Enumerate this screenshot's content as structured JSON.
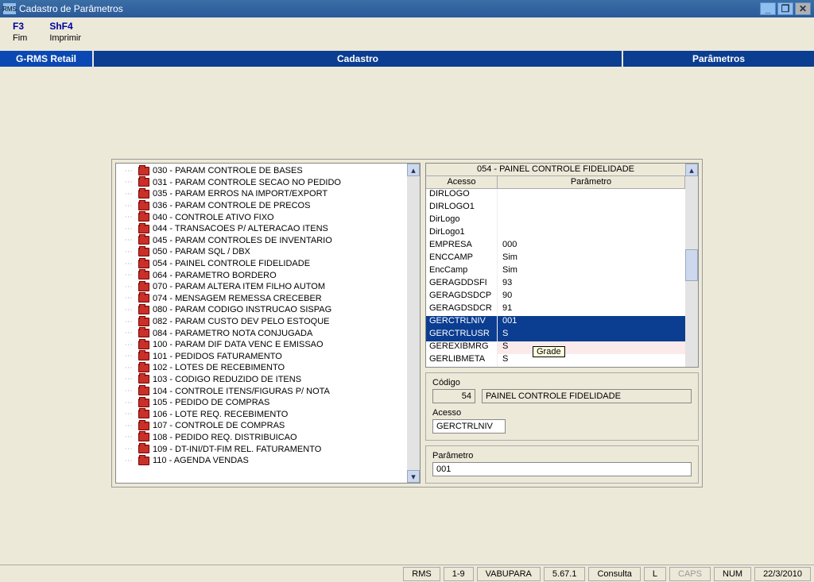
{
  "window": {
    "title": "Cadastro de Parâmetros",
    "app_icon_text": "RMS"
  },
  "menu": {
    "items": [
      {
        "shortcut": "F3",
        "label": "Fim"
      },
      {
        "shortcut": "ShF4",
        "label": "Imprimir"
      }
    ]
  },
  "ribbon": {
    "left": "G-RMS Retail",
    "center": "Cadastro",
    "right": "Parâmetros"
  },
  "tree": {
    "items": [
      "030 - PARAM CONTROLE DE BASES",
      "031 - PARAM CONTROLE SECAO NO PEDIDO",
      "035 - PARAM ERROS NA IMPORT/EXPORT",
      "036 - PARAM CONTROLE DE PRECOS",
      "040 - CONTROLE ATIVO FIXO",
      "044 - TRANSACOES P/ ALTERACAO ITENS",
      "045 - PARAM CONTROLES DE INVENTARIO",
      "050 - PARAM SQL / DBX",
      "054 - PAINEL CONTROLE FIDELIDADE",
      "064 - PARAMETRO BORDERO",
      "070 - PARAM ALTERA ITEM FILHO AUTOM",
      "074 - MENSAGEM REMESSA CRECEBER",
      "080 - PARAM CODIGO INSTRUCAO SISPAG",
      "082 - PARAM CUSTO DEV PELO ESTOQUE",
      "084 - PARAMETRO NOTA CONJUGADA",
      "100 - PARAM DIF DATA VENC E EMISSAO",
      "101 - PEDIDOS FATURAMENTO",
      "102 - LOTES DE RECEBIMENTO",
      "103 - CODIGO REDUZIDO DE ITENS",
      "104 - CONTROLE ITENS/FIGURAS P/ NOTA",
      "105 - PEDIDO DE COMPRAS",
      "106 - LOTE REQ. RECEBIMENTO",
      "107 - CONTROLE DE COMPRAS",
      "108 - PEDIDO REQ. DISTRIBUICAO",
      "109 - DT-INI/DT-FIM REL. FATURAMENTO",
      "110 - AGENDA VENDAS"
    ]
  },
  "grid": {
    "title": "054 - PAINEL CONTROLE FIDELIDADE",
    "col_acesso": "Acesso",
    "col_parametro": "Parâmetro",
    "rows": [
      {
        "acesso": "DIRLOGO",
        "param": ""
      },
      {
        "acesso": "DIRLOGO1",
        "param": ""
      },
      {
        "acesso": "DirLogo",
        "param": ""
      },
      {
        "acesso": "DirLogo1",
        "param": ""
      },
      {
        "acesso": "EMPRESA",
        "param": "000"
      },
      {
        "acesso": "ENCCAMP",
        "param": "Sim"
      },
      {
        "acesso": "EncCamp",
        "param": "Sim"
      },
      {
        "acesso": "GERAGDDSFI",
        "param": "93"
      },
      {
        "acesso": "GERAGDSDCP",
        "param": "90"
      },
      {
        "acesso": "GERAGDSDCR",
        "param": "91"
      },
      {
        "acesso": "GERCTRLNIV",
        "param": "001",
        "selected": true
      },
      {
        "acesso": "GERCTRLUSR",
        "param": "S",
        "selected": true
      },
      {
        "acesso": "GEREXIBMRG",
        "param": "S",
        "highlight": true
      },
      {
        "acesso": "GERLIBMETA",
        "param": "S"
      }
    ],
    "tooltip": "Grade"
  },
  "form": {
    "codigo_label": "Código",
    "codigo_value": "54",
    "codigo_desc": "PAINEL CONTROLE FIDELIDADE",
    "acesso_label": "Acesso",
    "acesso_value": "GERCTRLNIV",
    "param_label": "Parâmetro",
    "param_value": "001"
  },
  "status": {
    "app": "RMS",
    "pages": "1-9",
    "prog": "VABUPARA",
    "ver": "5.67.1",
    "mode": "Consulta",
    "l": "L",
    "caps": "CAPS",
    "num": "NUM",
    "date": "22/3/2010"
  }
}
